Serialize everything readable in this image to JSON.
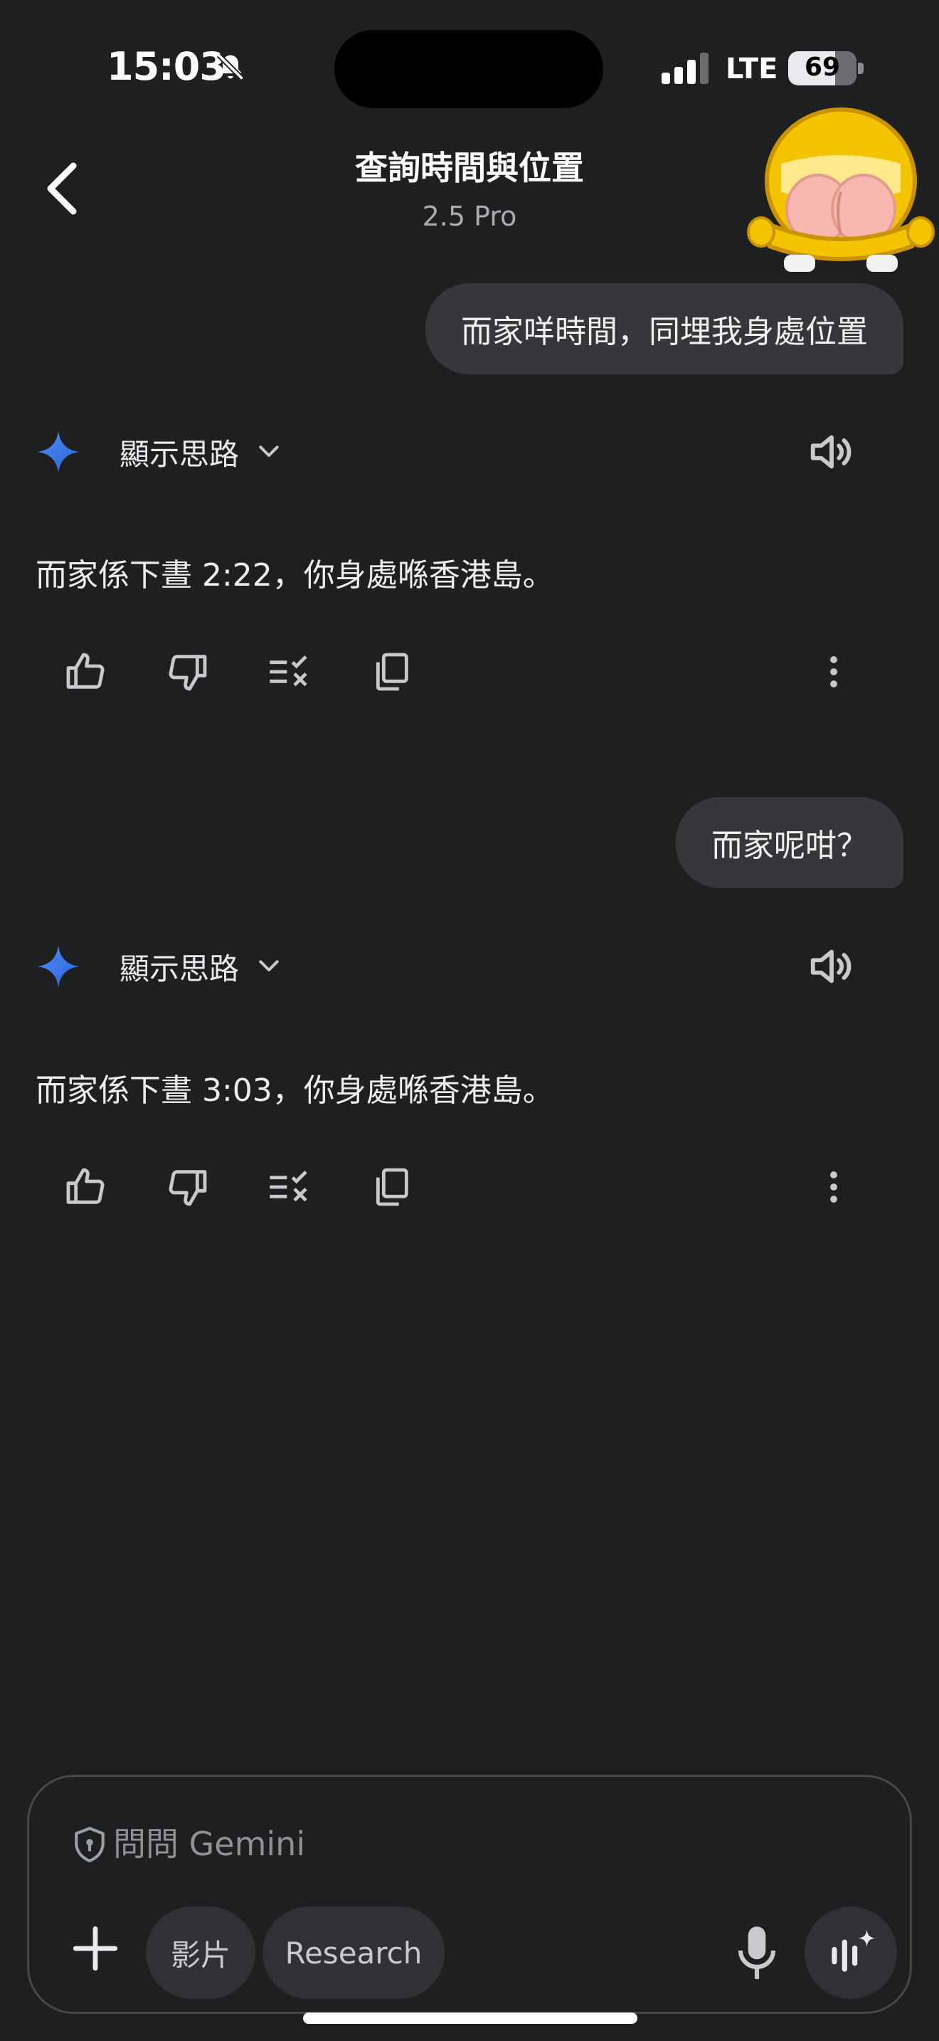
{
  "status_bar": {
    "time": "15:03",
    "network": "LTE",
    "battery": "69",
    "battery_level": 0.69
  },
  "header": {
    "title": "查詢時間與位置",
    "model": "2.5 Pro"
  },
  "conversation": [
    {
      "user_message": "而家咩時間，同埋我身處位置",
      "thoughts_label": "顯示思路",
      "reply": "而家係下晝 2:22，你身處喺香港島。"
    },
    {
      "user_message": "而家呢咁？",
      "thoughts_label": "顯示思路",
      "reply": "而家係下晝 3:03，你身處喺香港島。"
    }
  ],
  "composer": {
    "placeholder": "問問 Gemini",
    "chip_video": "影片",
    "chip_research": "Research"
  },
  "colors": {
    "background": "#1e1f21",
    "bubble": "#36373a",
    "gemini_blue": "#4285f4"
  }
}
